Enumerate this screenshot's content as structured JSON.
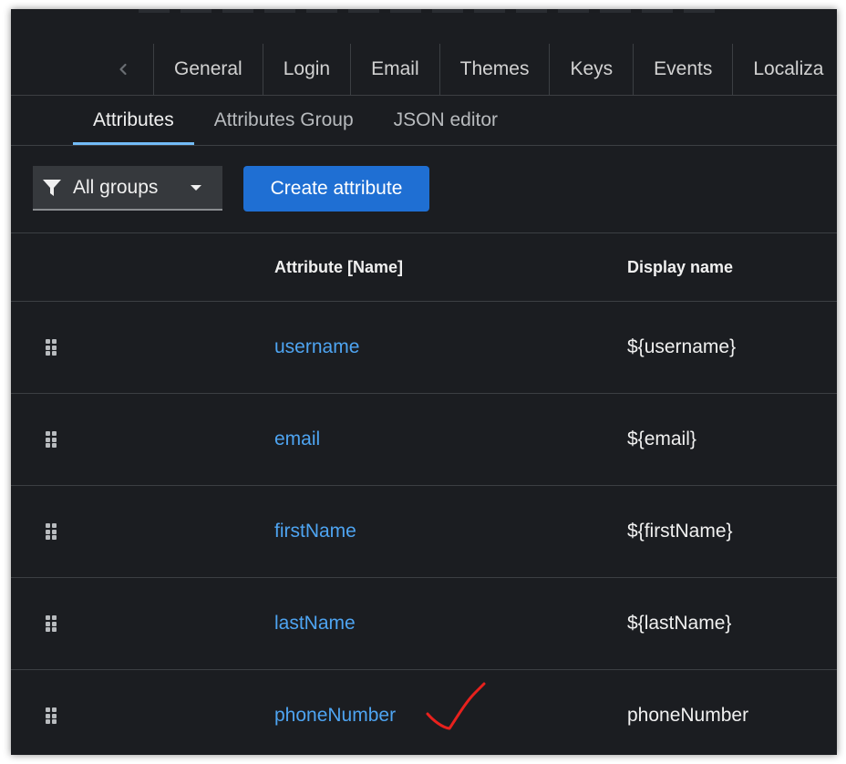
{
  "tabs": {
    "scroll_left_icon": "chevron-left-icon",
    "items": [
      "General",
      "Login",
      "Email",
      "Themes",
      "Keys",
      "Events",
      "Localiza"
    ]
  },
  "sub_tabs": {
    "items": [
      "Attributes",
      "Attributes Group",
      "JSON editor"
    ],
    "active": "Attributes"
  },
  "toolbar": {
    "filter_icon": "filter-icon",
    "filter_label": "All groups",
    "filter_caret_icon": "caret-down-icon",
    "create_label": "Create attribute"
  },
  "table": {
    "headers": {
      "name": "Attribute [Name]",
      "display": "Display name"
    },
    "rows": [
      {
        "name": "username",
        "display": "${username}"
      },
      {
        "name": "email",
        "display": "${email}"
      },
      {
        "name": "firstName",
        "display": "${firstName}"
      },
      {
        "name": "lastName",
        "display": "${lastName}"
      },
      {
        "name": "phoneNumber",
        "display": "phoneNumber"
      }
    ]
  },
  "annotation": {
    "checkmark_icon": "checkmark-icon",
    "color": "#e8211d"
  },
  "colors": {
    "background": "#1b1d21",
    "link": "#4ea4f1",
    "primary_button": "#1f6fd3",
    "active_tab_underline": "#73bcf7"
  }
}
